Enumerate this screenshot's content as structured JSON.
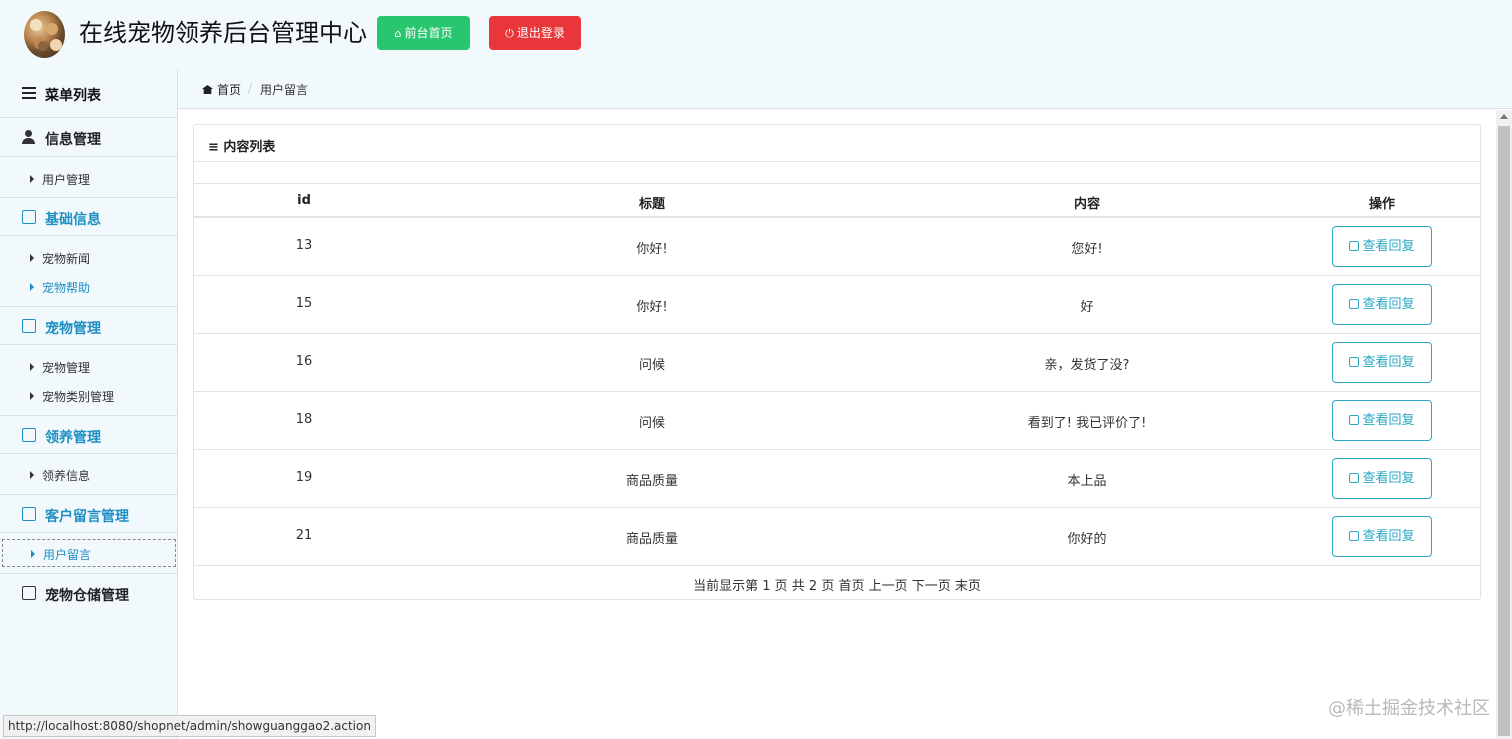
{
  "header": {
    "app_title": "在线宠物领养后台管理中心",
    "front_button": "前台首页",
    "logout_button": "退出登录",
    "colors": {
      "front": "#28c76f",
      "logout": "#e8363a",
      "accent": "#1d8fc2"
    }
  },
  "sidebar": {
    "menu_title": "菜单列表",
    "groups": [
      {
        "label": "信息管理",
        "icon": "user-icon",
        "items": [
          {
            "label": "用户管理"
          }
        ]
      },
      {
        "label": "基础信息",
        "icon": "edit-icon",
        "items": [
          {
            "label": "宠物新闻"
          },
          {
            "label": "宠物帮助"
          }
        ]
      },
      {
        "label": "宠物管理",
        "icon": "edit-icon",
        "items": [
          {
            "label": "宠物管理"
          },
          {
            "label": "宠物类别管理"
          }
        ]
      },
      {
        "label": "领养管理",
        "icon": "edit-icon",
        "items": [
          {
            "label": "领养信息"
          }
        ]
      },
      {
        "label": "客户留言管理",
        "icon": "edit-icon",
        "items": [
          {
            "label": "用户留言"
          }
        ]
      },
      {
        "label": "宠物仓储管理",
        "icon": "edit-icon",
        "items": []
      }
    ]
  },
  "breadcrumb": {
    "home": "首页",
    "separator": "/",
    "current": "用户留言"
  },
  "panel": {
    "title": "≡ 内容列表",
    "columns": [
      "id",
      "标题",
      "内容",
      "操作"
    ],
    "rows": [
      {
        "id": "13",
        "title": "你好!",
        "content": "您好!",
        "action": "查看回复"
      },
      {
        "id": "15",
        "title": "你好!",
        "content": "好",
        "action": "查看回复"
      },
      {
        "id": "16",
        "title": "问候",
        "content": "亲，发货了没?",
        "action": "查看回复"
      },
      {
        "id": "18",
        "title": "问候",
        "content": "看到了! 我已评价了!",
        "action": "查看回复"
      },
      {
        "id": "19",
        "title": "商品质量",
        "content": "本上品",
        "action": "查看回复"
      },
      {
        "id": "21",
        "title": "商品质量",
        "content": "你好的",
        "action": "查看回复"
      }
    ],
    "pager": "当前显示第 1 页 共 2 页 首页 上一页 下一页 末页"
  },
  "status_bar": {
    "url": "http://localhost:8080/shopnet/admin/showguanggao2.action"
  },
  "watermark": "@稀土掘金技术社区"
}
